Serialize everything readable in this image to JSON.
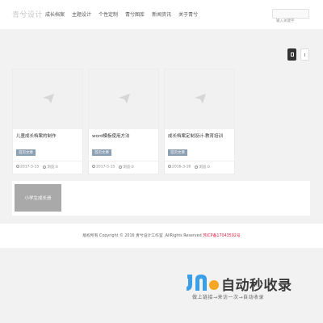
{
  "header": {
    "logo": "青兮设计",
    "nav": [
      "成长档案",
      "主题设计",
      "个性定制",
      "青兮图库",
      "新闻资讯",
      "关于青兮"
    ],
    "search_placeholder": "输入关键字"
  },
  "cards": [
    {
      "title": "儿童成长档案的制作",
      "tag": "首页文章",
      "date": "2017-5-15",
      "views_label": "浏览:",
      "views": "0"
    },
    {
      "title": "word模板使用方法",
      "tag": "首页文章",
      "date": "2017-5-15",
      "views_label": "浏览:",
      "views": "0"
    },
    {
      "title": "成长档案定制设计-教育培训",
      "tag": "首页文章",
      "date": "2016-3-16",
      "views_label": "浏览:",
      "views": "0"
    }
  ],
  "banner": {
    "text": "小学生成长册"
  },
  "footer": {
    "copyright": "版权所有 Copyright © 2016 青兮设计工作室 .AllRights Reserved",
    "icp": "苏ICP备17043592号"
  },
  "watermark": {
    "name": "自动秒收录",
    "slogan": "做上链接→来访一次→自动收录"
  },
  "colors": {
    "tag_bg": "#8ca0b3",
    "icp_red": "#dd2244",
    "watermark_blue": "#3b9fe8",
    "watermark_orange": "#f5a623"
  }
}
